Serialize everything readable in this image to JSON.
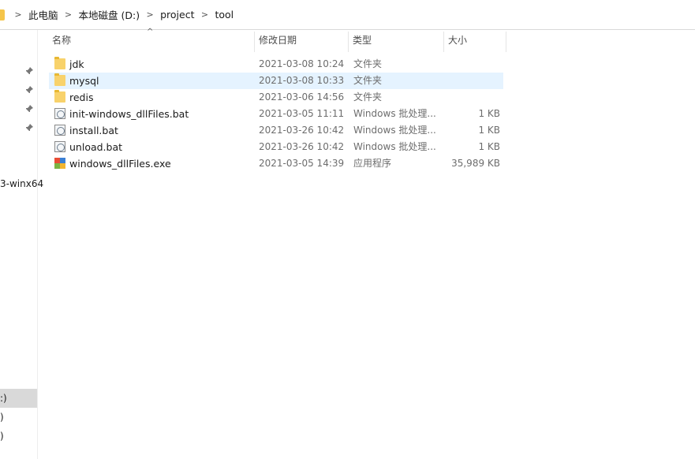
{
  "breadcrumb": {
    "items": [
      "此电脑",
      "本地磁盘 (D:)",
      "project",
      "tool"
    ],
    "separator": ">"
  },
  "nav": {
    "partial_items": [
      "3-winx64",
      ":)",
      ")",
      ")",
      ""
    ]
  },
  "columns": {
    "name": "名称",
    "date": "修改日期",
    "type": "类型",
    "size": "大小",
    "sort_indicator": "^"
  },
  "files": [
    {
      "name": "jdk",
      "date": "2021-03-08 10:24",
      "type": "文件夹",
      "size": "",
      "icon": "folder-icon",
      "selected": false
    },
    {
      "name": "mysql",
      "date": "2021-03-08 10:33",
      "type": "文件夹",
      "size": "",
      "icon": "folder-icon",
      "selected": true
    },
    {
      "name": "redis",
      "date": "2021-03-06 14:56",
      "type": "文件夹",
      "size": "",
      "icon": "folder-icon",
      "selected": false
    },
    {
      "name": "init-windows_dllFiles.bat",
      "date": "2021-03-05 11:11",
      "type": "Windows 批处理...",
      "size": "1 KB",
      "icon": "batch-file-icon",
      "selected": false
    },
    {
      "name": "install.bat",
      "date": "2021-03-26 10:42",
      "type": "Windows 批处理...",
      "size": "1 KB",
      "icon": "batch-file-icon",
      "selected": false
    },
    {
      "name": "unload.bat",
      "date": "2021-03-26 10:42",
      "type": "Windows 批处理...",
      "size": "1 KB",
      "icon": "batch-file-icon",
      "selected": false
    },
    {
      "name": "windows_dllFiles.exe",
      "date": "2021-03-05 14:39",
      "type": "应用程序",
      "size": "35,989 KB",
      "icon": "exe-file-icon",
      "selected": false
    }
  ],
  "colors": {
    "selection": "#e5f3ff",
    "folder": "#f8d26b",
    "nav_selected": "#d9d9d9"
  }
}
